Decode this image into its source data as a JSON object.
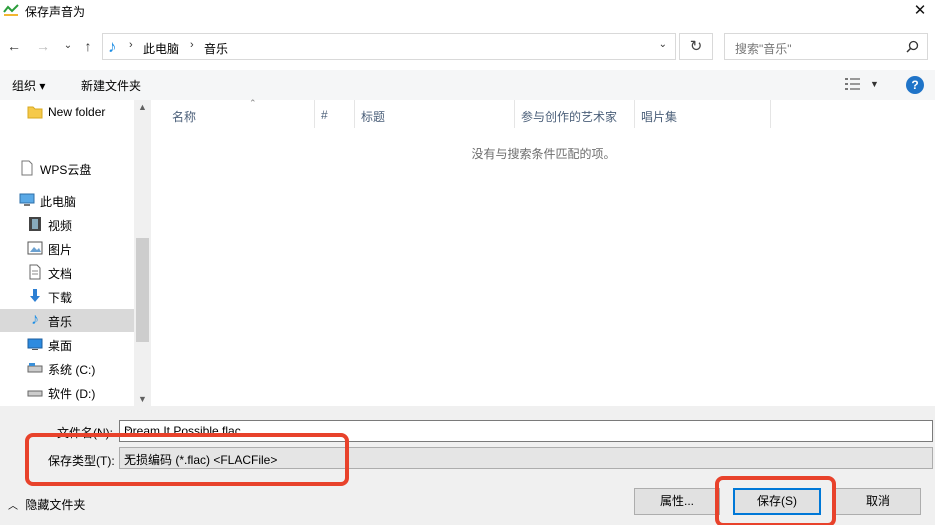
{
  "window": {
    "title": "保存声音为",
    "close_label": "✕"
  },
  "nav": {
    "back": "←",
    "forward": "→",
    "recent": "⌄",
    "up": "↑",
    "breadcrumb": [
      "此电脑",
      "音乐"
    ],
    "refresh": "↻",
    "search_placeholder": "搜索\"音乐\""
  },
  "toolbar": {
    "organize": "组织 ▾",
    "new_folder": "新建文件夹"
  },
  "sidebar": {
    "items": [
      {
        "label": "New folder",
        "icon": "folder-icon"
      },
      {
        "label": "WPS云盘",
        "icon": "document-icon"
      },
      {
        "label": "此电脑",
        "icon": "computer-icon"
      },
      {
        "label": "视频",
        "icon": "video-icon"
      },
      {
        "label": "图片",
        "icon": "picture-icon"
      },
      {
        "label": "文档",
        "icon": "document-icon"
      },
      {
        "label": "下载",
        "icon": "download-icon"
      },
      {
        "label": "音乐",
        "icon": "music-icon",
        "selected": true
      },
      {
        "label": "桌面",
        "icon": "desktop-icon"
      },
      {
        "label": "系统 (C:)",
        "icon": "drive-icon"
      },
      {
        "label": "软件 (D:)",
        "icon": "drive-icon"
      }
    ]
  },
  "columns": [
    "名称",
    "#",
    "标题",
    "参与创作的艺术家",
    "唱片集"
  ],
  "empty_message": "没有与搜索条件匹配的项。",
  "form": {
    "filename_label": "文件名(N):",
    "filename_value": "Dream It Possible.flac",
    "type_label": "保存类型(T):",
    "type_value": "无损编码 (*.flac)    <FLACFile>"
  },
  "footer": {
    "hide_folders": "隐藏文件夹",
    "properties": "属性...",
    "save": "保存(S)",
    "cancel": "取消"
  },
  "colors": {
    "highlight": "#e8422b",
    "accent": "#0078d7",
    "music_icon": "#1f8fe5"
  }
}
